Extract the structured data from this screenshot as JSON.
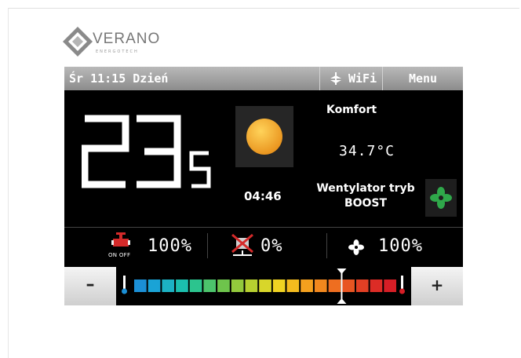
{
  "brand": {
    "name": "VERANO",
    "subtitle": "ENERGOTECH"
  },
  "status_bar": {
    "day": "Śr",
    "time": "11:15",
    "mode": "Dzień",
    "wifi_label": "WiFi",
    "menu_label": "Menu"
  },
  "main": {
    "temperature_whole": "23",
    "temperature_decimal": "5",
    "weather_icon": "sun-icon",
    "preset_label": "Komfort",
    "secondary_temperature": "34.7°C",
    "timer": "04:46",
    "ventilation_mode_line1": "Wentylator tryb",
    "ventilation_mode_line2": "BOOST",
    "fan_icon": "fan-icon"
  },
  "stats": {
    "valve_icon": "valve-icon",
    "valve_on_off": "ON OFF",
    "valve_value": "100%",
    "crossed_icon": "disabled-device-icon",
    "crossed_value": "0%",
    "fan_icon": "fan-icon",
    "fan_value": "100%"
  },
  "controls": {
    "minus_label": "–",
    "plus_label": "+",
    "setpoint_fraction": 0.79,
    "scale_colors": [
      "#1b8fd6",
      "#1aa3d6",
      "#1cb2c4",
      "#1bbfae",
      "#2cc48e",
      "#4cc46c",
      "#6ec44c",
      "#93c93c",
      "#b7d030",
      "#d8d62a",
      "#f0d322",
      "#f4bb1e",
      "#f4a01e",
      "#f2881e",
      "#ee6e20",
      "#e85522",
      "#e23f24",
      "#dc2c26",
      "#d61e26"
    ]
  },
  "colors": {
    "screen_bg": "#000000",
    "status_bar": "#a5a5a5",
    "fan_green": "#2fa84a",
    "valve_red": "#d42a2a",
    "sun": "#f2a81d"
  }
}
